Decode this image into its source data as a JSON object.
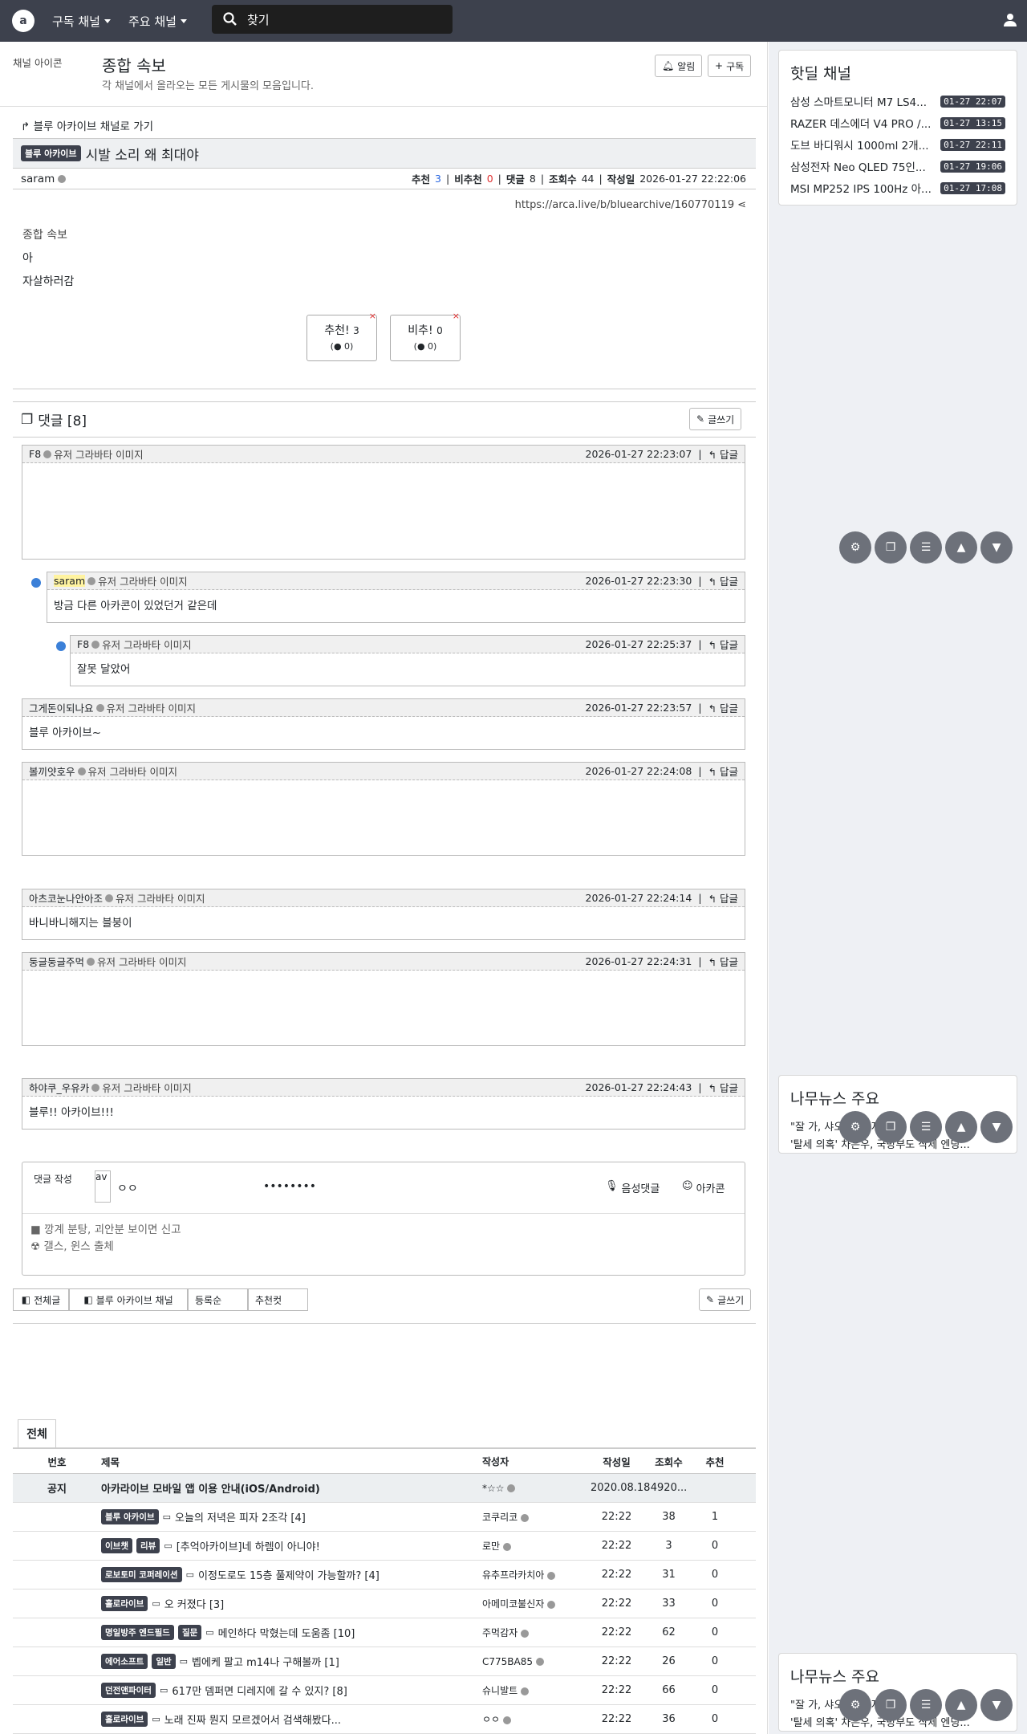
{
  "topbar": {
    "logo": "a",
    "menu1": "구독 채널",
    "menu2": "주요 채널",
    "search_placeholder": "찾기"
  },
  "channel": {
    "icon_alt": "채널 아이콘",
    "title": "종합 속보",
    "desc": "각 채널에서 올라오는 모든 게시물의 모음입니다.",
    "alarm": "알림",
    "subscribe": "구독"
  },
  "article": {
    "back_link": "블루 아카이브 채널로 가기",
    "category": "블루 아카이브",
    "title": "시발 소리 왜 최대야",
    "author": "saram",
    "rec_label": "추천",
    "rec": "3",
    "unrec_label": "비추천",
    "unrec": "0",
    "cmt_label": "댓글",
    "cmt": "8",
    "view_label": "조회수",
    "views": "44",
    "date_label": "작성일",
    "date": "2026-01-27 22:22:06",
    "url": "https://arca.live/b/bluearchive/160770119",
    "img_alt": "종합 속보",
    "line1": "아",
    "line2": "자살하러감",
    "vote_up": "추천!",
    "vote_up_n": "3",
    "vote_up_sub": "0",
    "vote_down": "비추!",
    "vote_down_n": "0",
    "vote_down_sub": "0"
  },
  "comments_head": {
    "title": "댓글 [8]",
    "write": "글쓰기"
  },
  "avatar_alt": "유저 그라바타 이미지",
  "reply_label": "답글",
  "comments": [
    {
      "user": "F8",
      "date": "2026-01-27 22:23:07",
      "text": ""
    },
    {
      "user": "saram",
      "date": "2026-01-27 22:23:30",
      "text": "방금 다른 아카콘이 있었던거 같은데"
    },
    {
      "user": "F8",
      "date": "2026-01-27 22:25:37",
      "text": "잘못 달았어"
    },
    {
      "user": "그게돈이되나요",
      "date": "2026-01-27 22:23:57",
      "text": "블루 아카이브~"
    },
    {
      "user": "볼끼얏호우",
      "date": "2026-01-27 22:24:08",
      "text": ""
    },
    {
      "user": "아츠코눈나안아조",
      "date": "2026-01-27 22:24:14",
      "text": "바니바니해지는 블붕이"
    },
    {
      "user": "둥글둥글주먹",
      "date": "2026-01-27 22:24:31",
      "text": ""
    },
    {
      "user": "하야쿠_우유카",
      "date": "2026-01-27 22:24:43",
      "text": "블루!! 아카이브!!!"
    }
  ],
  "write_box": {
    "label": "댓글 작성",
    "avatar": "av",
    "name": "ㅇㅇ",
    "password": "••••••••",
    "voice": "음성댓글",
    "arcacon": "아카콘",
    "rule1": "■ 깡계 분탕, 괴안분 보이면 신고",
    "rule2": "☢ 갤스, 윈스 출체"
  },
  "list_tools": {
    "all": "전체글",
    "channel": "블루 아카이브 채널",
    "sort": "등록순",
    "rec": "추천컷",
    "write": "글쓰기"
  },
  "list_tab": "전체",
  "list_head": {
    "no": "번호",
    "title": "제목",
    "author": "작성자",
    "date": "작성일",
    "views": "조회수",
    "rec": "추천"
  },
  "notice": {
    "no": "공지",
    "title": "아카라이브 모바일 앱 이용 안내(iOS/Android)",
    "author": "*☆☆",
    "date": "2020.08.18",
    "views": "4920...",
    "rec": ""
  },
  "rows": [
    {
      "badges": [
        "블루 아카이브"
      ],
      "title": "오늘의 저녁은 피자 2조각 [4]",
      "author": "코쿠리코",
      "date": "22:22",
      "views": "38",
      "rec": "1"
    },
    {
      "badges": [
        "이브챗",
        "리뷰"
      ],
      "title": "[추억아카이브]네 하렘이 아니야!",
      "author": "로만",
      "date": "22:22",
      "views": "3",
      "rec": "0"
    },
    {
      "badges": [
        "로보토미 코퍼레이션"
      ],
      "title": "이정도로도 15층 풀제약이 가능할까? [4]",
      "author": "유추프라카치아",
      "date": "22:22",
      "views": "31",
      "rec": "0"
    },
    {
      "badges": [
        "홀로라이브"
      ],
      "title": "오 커졌다 [3]",
      "author": "아메미코불신자",
      "date": "22:22",
      "views": "33",
      "rec": "0"
    },
    {
      "badges": [
        "명일방주 엔드필드",
        "질문"
      ],
      "title": "메인하다 막혔는데 도움좀 [10]",
      "author": "주먹감자",
      "date": "22:22",
      "views": "62",
      "rec": "0"
    },
    {
      "badges": [
        "에어소프트",
        "일반"
      ],
      "title": "벱에케 팔고 m14나 구해볼까 [1]",
      "author": "C775BA85",
      "date": "22:22",
      "views": "26",
      "rec": "0"
    },
    {
      "badges": [
        "던전앤파이터"
      ],
      "title": "617만 뎀퍼면 디레지에 갈 수 있지? [8]",
      "author": "슈니발트",
      "date": "22:22",
      "views": "66",
      "rec": "0"
    },
    {
      "badges": [
        "홀로라이브"
      ],
      "title": "노래 진짜 뭔지 모르겠어서 검색해봤다...",
      "author": "ㅇㅇ",
      "date": "22:22",
      "views": "36",
      "rec": "0"
    }
  ],
  "sidebar": {
    "hot_title": "핫딜 채널",
    "hot": [
      {
        "t": "삼성 스마트모니터 M7 LS4...",
        "d": "01-27 22:07"
      },
      {
        "t": "RAZER 데스에더 V4 PRO /...",
        "d": "01-27 13:15"
      },
      {
        "t": "도브 바디워시 1000ml 2개...",
        "d": "01-27 22:11"
      },
      {
        "t": "삼성전자 Neo QLED 75인...",
        "d": "01-27 19:06"
      },
      {
        "t": "MSI MP252 IPS 100Hz 아...",
        "d": "01-27 17:08"
      }
    ],
    "news_title": "나무뉴스 주요",
    "news1": "\"잘 가, 샤오\"... 마지막...",
    "news2": "'탈세 의혹' 차은우, 국방부도 삭제 엔딩...",
    "news_title2": "나무뉴스 주요",
    "news3": "\"잘 가, 샤오\"... 마지막...",
    "news4": "'탈세 의혹' 차은우, 국방부도 삭제 엔딩..."
  }
}
